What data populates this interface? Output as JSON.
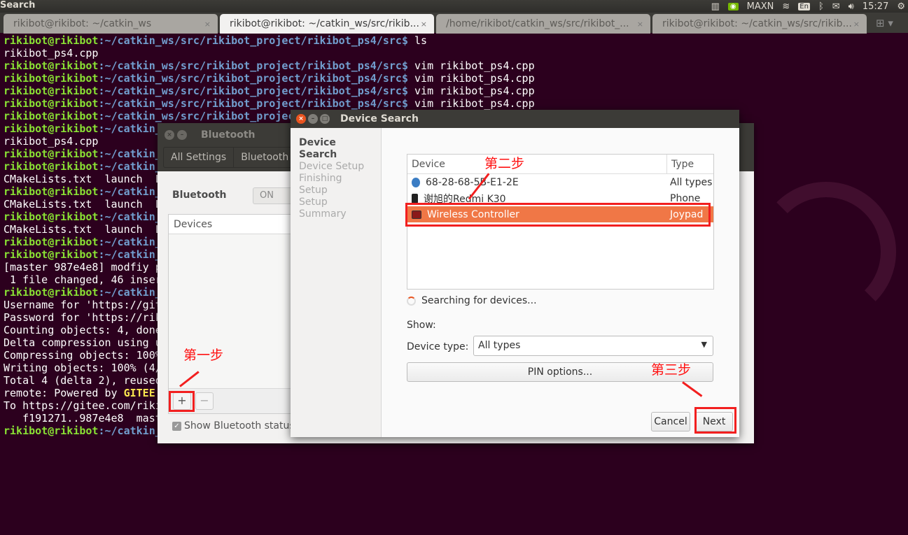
{
  "topbar": {
    "title": "Search",
    "tray": {
      "power_mode": "MAXN",
      "keyboard": "En",
      "time": "15:27"
    }
  },
  "tabs": [
    {
      "label": "rikibot@rikibot: ~/catkin_ws",
      "active": false
    },
    {
      "label": "rikibot@rikibot: ~/catkin_ws/src/rikib...",
      "active": true
    },
    {
      "label": "/home/rikibot/catkin_ws/src/rikibot_...",
      "active": false
    },
    {
      "label": "rikibot@rikibot: ~/catkin_ws/src/rikib...",
      "active": false
    }
  ],
  "terminal": {
    "lines": [
      {
        "user": "rikibot@rikibot",
        "path": ":~/catkin_ws/src/rikibot_project/rikibot_ps4/src$",
        "cmd": " ls"
      },
      {
        "text": "rikibot_ps4.cpp"
      },
      {
        "user": "rikibot@rikibot",
        "path": ":~/catkin_ws/src/rikibot_project/rikibot_ps4/src$",
        "cmd": " vim rikibot_ps4.cpp"
      },
      {
        "user": "rikibot@rikibot",
        "path": ":~/catkin_ws/src/rikibot_project/rikibot_ps4/src$",
        "cmd": " vim rikibot_ps4.cpp"
      },
      {
        "user": "rikibot@rikibot",
        "path": ":~/catkin_ws/src/rikibot_project/rikibot_ps4/src$",
        "cmd": " vim rikibot_ps4.cpp"
      },
      {
        "user": "rikibot@rikibot",
        "path": ":~/catkin_ws/src/rikibot_project/rikibot_ps4/src$",
        "cmd": " vim rikibot_ps4.cpp"
      },
      {
        "user": "rikibot@rikibot",
        "path": ":~/catkin_ws/src/rikibot_projec",
        "cmd": ""
      },
      {
        "user": "rikibot@rikibot",
        "path": ":~/catkin_",
        "cmd": ""
      },
      {
        "text": "rikibot_ps4.cpp"
      },
      {
        "user": "rikibot@rikibot",
        "path": ":~/catkin_",
        "cmd": ""
      },
      {
        "user": "rikibot@rikibot",
        "path": ":~/catkin_",
        "cmd": ""
      },
      {
        "text": "CMakeLists.txt  launch  L"
      },
      {
        "user": "rikibot@rikibot",
        "path": ":~/catkin_",
        "cmd": ""
      },
      {
        "text": "CMakeLists.txt  launch  L"
      },
      {
        "user": "rikibot@rikibot",
        "path": ":~/catkin_",
        "cmd": ""
      },
      {
        "text": "CMakeLists.txt  launch  L"
      },
      {
        "user": "rikibot@rikibot",
        "path": ":~/catkin_",
        "cmd": ""
      },
      {
        "user": "rikibot@rikibot",
        "path": ":~/catkin_",
        "cmd": ""
      },
      {
        "text": "[master 987e4e8] modfiy p"
      },
      {
        "text": " 1 file changed, 46 inser"
      },
      {
        "user": "rikibot@rikibot",
        "path": ":~/catkin_",
        "cmd": ""
      },
      {
        "text": "Username for 'https://git"
      },
      {
        "text": "Password for 'https://rik"
      },
      {
        "text": "Counting objects: 4, done"
      },
      {
        "text": "Delta compression using u"
      },
      {
        "text": "Compressing objects: 100%"
      },
      {
        "text": "Writing objects: 100% (4/"
      },
      {
        "text": "Total 4 (delta 2), reused"
      },
      {
        "text": "remote: Powered by ",
        "hl": "GITEE."
      },
      {
        "text": "To https://gitee.com/riki"
      },
      {
        "text": "   f191271..987e4e8  mast"
      },
      {
        "user": "rikibot@rikibot",
        "path": ":~/catkin_",
        "cmd": ""
      }
    ]
  },
  "bluetooth_window": {
    "title": "Bluetooth",
    "breadcrumbs": [
      "All Settings",
      "Bluetooth"
    ],
    "bluetooth_label": "Bluetooth",
    "switch_state": "ON",
    "devices_header": "Devices",
    "add_label": "+",
    "remove_label": "−",
    "show_status_label": "Show Bluetooth status",
    "show_status_checked": true
  },
  "device_search": {
    "title": "Device Search",
    "steps": [
      "Device Search",
      "Device Setup",
      "Finishing Setup",
      "Setup Summary"
    ],
    "columns": [
      "Device",
      "Type"
    ],
    "devices": [
      {
        "name": "68-28-68-5B-E1-2E",
        "type": "All types",
        "icon": "bluetooth-icon"
      },
      {
        "name": "谢旭的Redmi K30",
        "type": "Phone",
        "icon": "phone-icon"
      },
      {
        "name": "Wireless Controller",
        "type": "Joypad",
        "icon": "joypad-icon",
        "selected": true
      }
    ],
    "status": "Searching for devices...",
    "show_label": "Show:",
    "device_type_label": "Device type:",
    "device_type_value": "All types",
    "pin_button": "PIN options...",
    "cancel_button": "Cancel",
    "next_button": "Next"
  },
  "annotations": {
    "step1": "第一步",
    "step2": "第二步",
    "step3": "第三步"
  },
  "colors": {
    "selection": "#f07746",
    "annotation": "#f21f1f",
    "terminal_bg": "#2c001e"
  }
}
